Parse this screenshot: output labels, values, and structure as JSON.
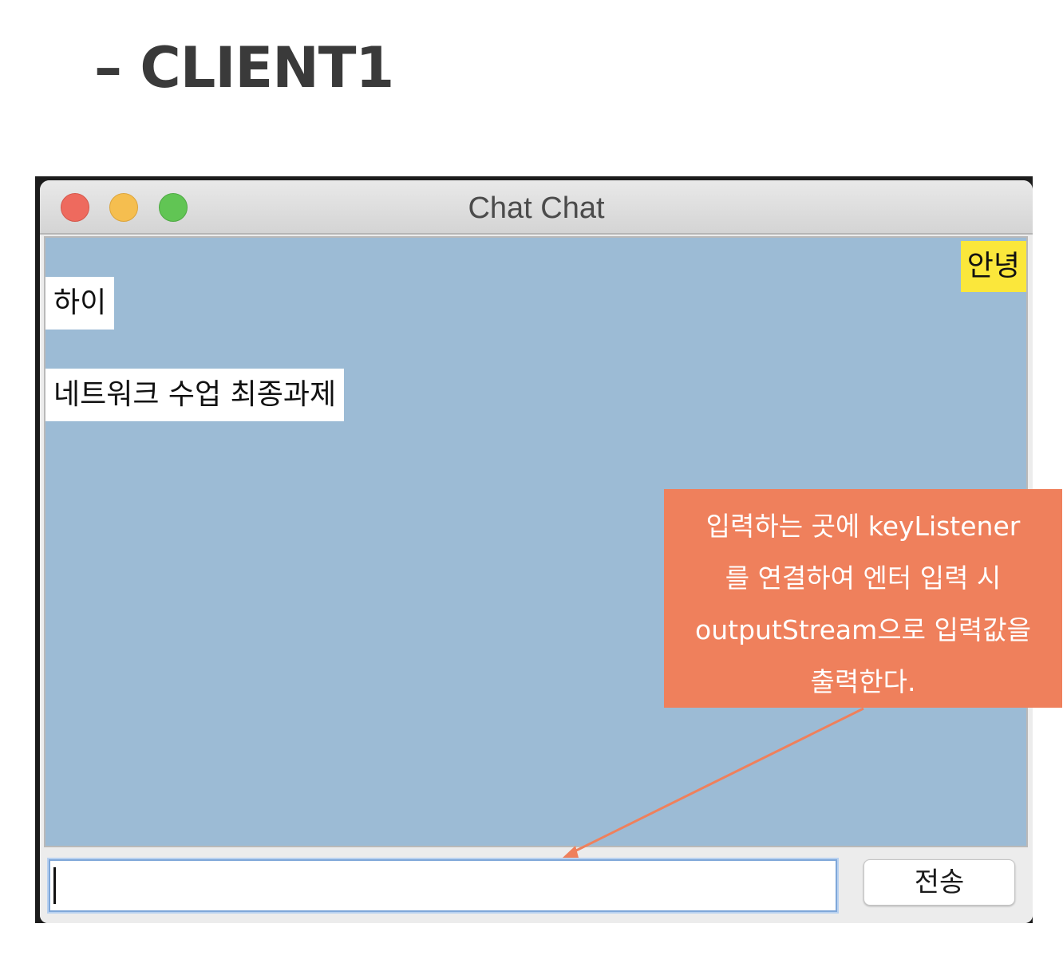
{
  "heading": "– CLIENT1",
  "window": {
    "title": "Chat Chat"
  },
  "messages": [
    {
      "text": "안녕",
      "side": "right",
      "color": "#fbe73b"
    },
    {
      "text": "하이",
      "side": "left",
      "color": "#ffffff"
    },
    {
      "text": "네트워크 수업 최종과제",
      "side": "left",
      "color": "#ffffff"
    }
  ],
  "input": {
    "value": ""
  },
  "send_button": {
    "label": "전송"
  },
  "callout": {
    "lines": [
      "입력하는 곳에 keyListener",
      "를 연결하여 엔터 입력 시",
      "outputStream으로 입력값을",
      "출력한다."
    ],
    "color": "#ef805c"
  },
  "colors": {
    "chat_background": "#9cbbd5",
    "my_bubble": "#fbe73b",
    "other_bubble": "#ffffff"
  }
}
